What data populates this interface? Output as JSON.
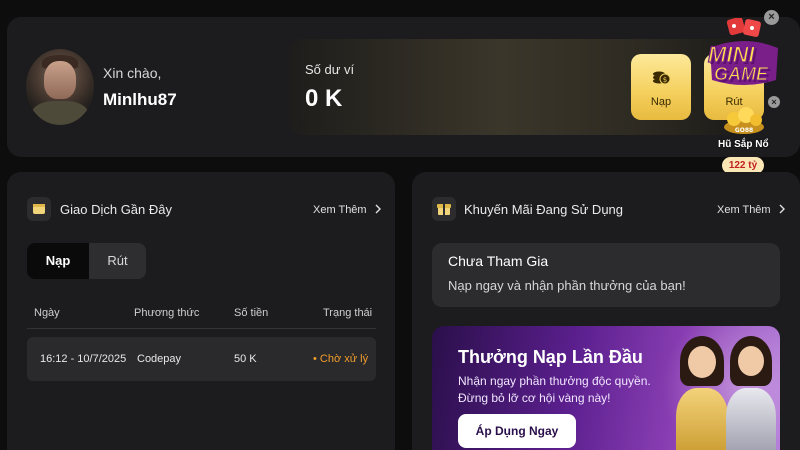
{
  "header": {
    "greeting": "Xin chào,",
    "username": "Minlhu87",
    "wallet_label": "Số dư ví",
    "wallet_value": "0 K",
    "deposit_button": "Nạp",
    "withdraw_button": "Rút"
  },
  "minigame": {
    "logo_line1": "MINI",
    "logo_line2": "GAME",
    "badge": "GO88",
    "jackpot_label": "Hũ Sắp Nổ",
    "jackpot_value": "122 tỷ",
    "close_icon": "×"
  },
  "transactions": {
    "title": "Giao Dịch Gần Đây",
    "more": "Xem Thêm",
    "tabs": [
      "Nạp",
      "Rút"
    ],
    "columns": [
      "Ngày",
      "Phương thức",
      "Số tiền",
      "Trạng thái"
    ],
    "rows": [
      {
        "date": "16:12 - 10/7/2025",
        "method": "Codepay",
        "amount": "50 K",
        "status": "• Chờ xử lý"
      }
    ]
  },
  "promotions": {
    "title": "Khuyến Mãi Đang Sử Dụng",
    "more": "Xem Thêm",
    "empty_title": "Chưa Tham Gia",
    "empty_desc": "Nạp ngay và nhận phần thưởng của bạn!",
    "banner_title": "Thưởng Nạp Lần Đầu",
    "banner_line1": "Nhận ngay phần thưởng độc quyền.",
    "banner_line2": "Đừng bỏ lỡ cơ hội vàng này!",
    "banner_button": "Áp Dụng Ngay"
  },
  "colors": {
    "background": "#0d0d0e",
    "card": "#1c1c1e",
    "gold": "#f4cf5c",
    "status_pending": "#f29d2b",
    "banner_purple": "#5b1f8e"
  },
  "icons": [
    "wallet-icon",
    "gift-icon",
    "chevron-right-icon",
    "coin-icon",
    "close-icon"
  ]
}
